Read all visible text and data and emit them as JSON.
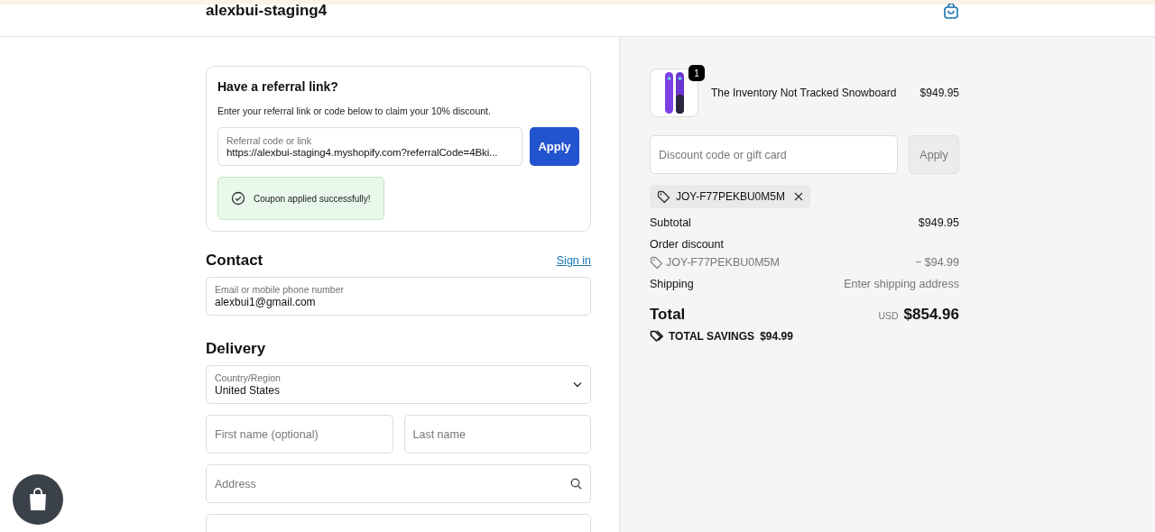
{
  "header": {
    "store_name": "alexbui-staging4"
  },
  "referral": {
    "title": "Have a referral link?",
    "description": "Enter your referral link or code below to claim your 10% discount.",
    "field": {
      "label": "Referral code or link",
      "value": "https://alexbui-staging4.myshopify.com?referralCode=4Bki..."
    },
    "apply_button": "Apply",
    "message": "Coupon applied successfully!"
  },
  "contact": {
    "title": "Contact",
    "sign_in_link": "Sign in",
    "field": {
      "label": "Email or mobile phone number",
      "value": "alexbui1@gmail.com"
    }
  },
  "delivery": {
    "title": "Delivery",
    "country": {
      "label": "Country/Region",
      "value": "United States"
    },
    "first_name": {
      "placeholder": "First name (optional)"
    },
    "last_name": {
      "placeholder": "Last name"
    },
    "address": {
      "placeholder": "Address"
    }
  },
  "summary": {
    "item": {
      "quantity": "1",
      "name": "The Inventory Not Tracked Snowboard",
      "price": "$949.95"
    },
    "discount_field": {
      "placeholder": "Discount code or gift card"
    },
    "apply_button": "Apply",
    "applied_code": "JOY-F77PEKBU0M5M",
    "subtotal": {
      "label": "Subtotal",
      "value": "$949.95"
    },
    "order_discount": {
      "label": "Order discount",
      "code": "JOY-F77PEKBU0M5M",
      "value": "− $94.99"
    },
    "shipping": {
      "label": "Shipping",
      "value": "Enter shipping address"
    },
    "total": {
      "label": "Total",
      "currency": "USD",
      "value": "$854.96"
    },
    "savings": {
      "label": "TOTAL SAVINGS",
      "value": "$94.99"
    }
  }
}
